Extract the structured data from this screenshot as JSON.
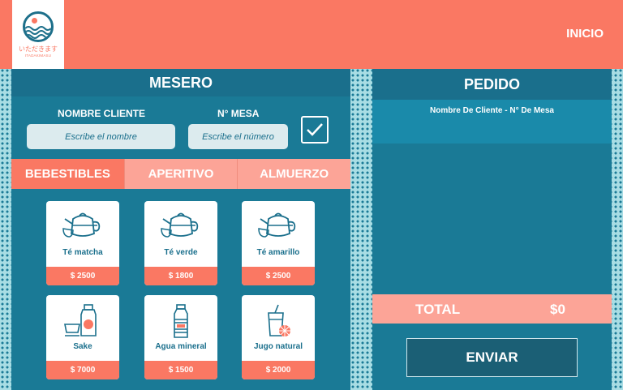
{
  "header": {
    "logo": {
      "jp_text": "いただきます",
      "sub_text": "ITADAKIMASU"
    },
    "nav": {
      "inicio": "INICIO"
    }
  },
  "mesero": {
    "title": "MESERO",
    "client_label": "NOMBRE CLIENTE",
    "client_placeholder": "Escribe el nombre",
    "table_label": "N° MESA",
    "table_placeholder": "Escribe el número",
    "tabs": [
      {
        "label": "BEBESTIBLES",
        "active": true
      },
      {
        "label": "APERITIVO",
        "active": false
      },
      {
        "label": "ALMUERZO",
        "active": false
      }
    ],
    "products": [
      {
        "name": "Té matcha",
        "price": "$ 2500",
        "icon": "teapot-icon"
      },
      {
        "name": "Té verde",
        "price": "$ 1800",
        "icon": "teapot-icon"
      },
      {
        "name": "Té amarillo",
        "price": "$ 2500",
        "icon": "teapot-icon"
      },
      {
        "name": "Sake",
        "price": "$ 7000",
        "icon": "sake-bottle-icon"
      },
      {
        "name": "Agua mineral",
        "price": "$ 1500",
        "icon": "water-bottle-icon"
      },
      {
        "name": "Jugo natural",
        "price": "$ 2000",
        "icon": "juice-glass-icon"
      }
    ]
  },
  "pedido": {
    "title": "PEDIDO",
    "subtitle": "Nombre De Cliente - N° De Mesa",
    "total_label": "TOTAL",
    "total_value": "$0",
    "send_label": "ENVIAR"
  },
  "colors": {
    "coral": "#fa7863",
    "coral_light": "#fca497",
    "teal": "#1a7a96",
    "teal_dark": "#1a6f8c"
  }
}
